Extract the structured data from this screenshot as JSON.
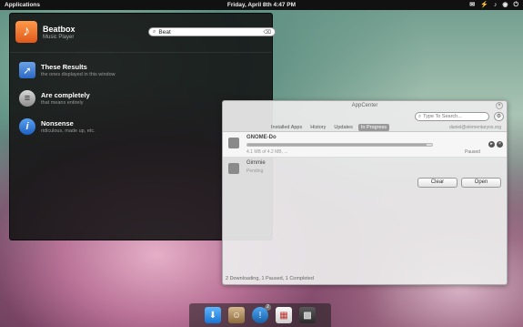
{
  "top_panel": {
    "applications_label": "Applications",
    "clock": "Friday, April 8th 4:47 PM",
    "tray": {
      "mail_icon": "✉",
      "wifi_icon": "⚡",
      "volume_icon": "♪",
      "eye_icon": "◉",
      "power_icon": "⏻"
    }
  },
  "launcher": {
    "app": {
      "title": "Beatbox",
      "subtitle": "Music Player",
      "icon_glyph": "♪"
    },
    "search": {
      "value": "Beat",
      "icon_glyph": "⌕",
      "clear_glyph": "⌫"
    },
    "results": [
      {
        "title": "These Results",
        "subtitle": "the ones displayed in this window",
        "icon_glyph": "➚"
      },
      {
        "title": "Are completely",
        "subtitle": "that means entirely",
        "icon_glyph": "≡"
      },
      {
        "title": "Nonsense",
        "subtitle": "ridiculous, made up, etc.",
        "icon_glyph": "i"
      }
    ]
  },
  "appcenter": {
    "title": "AppCenter",
    "close_glyph": "×",
    "search_placeholder": "Type To Search...",
    "tabs": [
      "Installed Apps",
      "History",
      "Updates",
      "In Progress"
    ],
    "account": "daniel@elementaryos.org",
    "downloads": [
      {
        "name": "GNOME-Do",
        "progress": 0.97,
        "meta": "4.1 MB of 4.2 MB, ...",
        "status": "Paused"
      },
      {
        "name": "Gimmie",
        "subtitle": "Pending"
      }
    ],
    "clear_label": "Clear",
    "open_label": "Open",
    "status": "2 Downloading, 1 Paused, 1 Completed"
  },
  "dock": {
    "items": [
      "downloads",
      "contacts",
      "chat",
      "calendar",
      "app-grid"
    ],
    "chat_badge": "2"
  }
}
